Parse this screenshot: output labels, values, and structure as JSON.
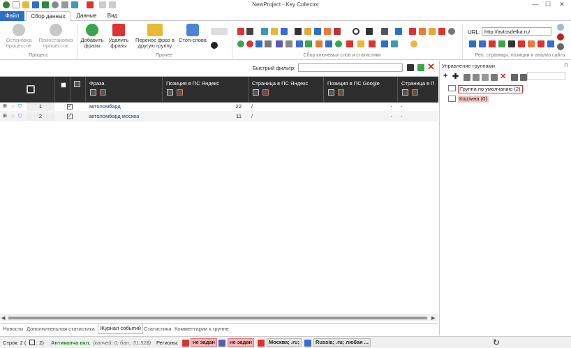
{
  "window": {
    "title": "NewProject - Key Collector"
  },
  "tabs": [
    {
      "label": "Файл"
    },
    {
      "label": "Сбор данных"
    },
    {
      "label": "Данные"
    },
    {
      "label": "Вид"
    }
  ],
  "ribbon": {
    "process": {
      "stop": "Остановка процессов",
      "pause": "Приостановка процессов",
      "group_label": "Процесс"
    },
    "add_phrases": "Добавить фразы",
    "delete_phrases": "Удалить фразы",
    "move_phrases": "Перенос фраз в другую группу",
    "stopwords": "Стоп-слова",
    "other_label": "Прочее",
    "collect_label": "Сбор ключевых слов и статистики",
    "url_label": "URL:",
    "url_value": "http://avtosdelka.ru/",
    "rel_label": "Рел. страницы, позиции и анализ сайта"
  },
  "filter": {
    "label": "Быстрый фильтр:",
    "value": ""
  },
  "grid": {
    "columns": [
      "Фраза",
      "Позиция в ПС Яндекс",
      "Страница в ПС Яндекс",
      "Позиция в ПС Google",
      "Страница в П"
    ],
    "rows": [
      {
        "num": "1",
        "phrase": "автоломбард",
        "pos_yandex": "22",
        "page_yandex": "/",
        "pos_google": "-",
        "page_google": "-"
      },
      {
        "num": "2",
        "phrase": "автоломбард москва",
        "pos_yandex": "11",
        "page_yandex": "/",
        "pos_google": "-",
        "page_google": "-"
      }
    ]
  },
  "groups": {
    "title": "Управление группами",
    "items": [
      {
        "label": "Группа по умолчанию (2)"
      },
      {
        "label": "Корзина (0)"
      }
    ]
  },
  "bottom_tabs": [
    "Новости",
    "Дополнительная статистика",
    "Журнал событий",
    "Статистика",
    "Комментарии к группе"
  ],
  "status": {
    "rows_label": "Строк: 2 (",
    "rows_sel": ": 2)",
    "antikapcha": "Антикапча вкл.",
    "antikapcha_detail": "(капчей: 0; бал.: 51,52$)",
    "regions_label": "Регионы:",
    "region_1": "не задан",
    "region_2": "не задан",
    "region_3": "Москва; .ru;",
    "region_4": "Russia; .ru; любая ..."
  },
  "colors": {
    "accent": "#2b6fc7",
    "header_dark": "#2e2e2e",
    "red_badge": "#f2b4b4",
    "green_text": "#1e8a1e"
  }
}
